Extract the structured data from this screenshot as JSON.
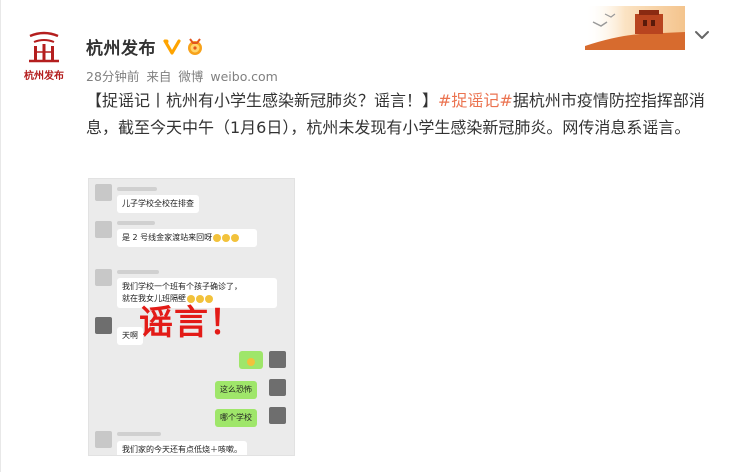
{
  "account": {
    "name": "杭州发布",
    "avatar_text": "杭州发布"
  },
  "meta": {
    "time": "28分钟前",
    "source_prefix": "来自",
    "source": "微博",
    "source_site": "weibo.com"
  },
  "post": {
    "part1": "【捉谣记丨杭州有小学生感染新冠肺炎？谣言！】",
    "hashtag": "#捉谣记#",
    "part2": "据杭州市疫情防控指挥部消息，截至今天中午（1月6日），杭州未发现有小学生感染新冠肺炎。网传消息系谣言。"
  },
  "screenshot": {
    "rumor_label": "谣言！",
    "messages": [
      "儿子学校全校在排查",
      "是 2 号线金家渡站来回呀",
      "我们学校一个班有个孩子确诊了，",
      "就在我女儿班隔壁",
      "天啊",
      "这么恐怖",
      "哪个学校",
      "我们家的今天还有点低烧＋咳嗽。"
    ]
  },
  "colors": {
    "hashtag": "#eb7350",
    "verified": "#ffa400",
    "rumor": "#e31b17",
    "brand_red": "#b41e1e"
  },
  "icons": {
    "verified": "verified-v-icon",
    "medal": "medal-icon",
    "more": "chevron-down-icon"
  }
}
